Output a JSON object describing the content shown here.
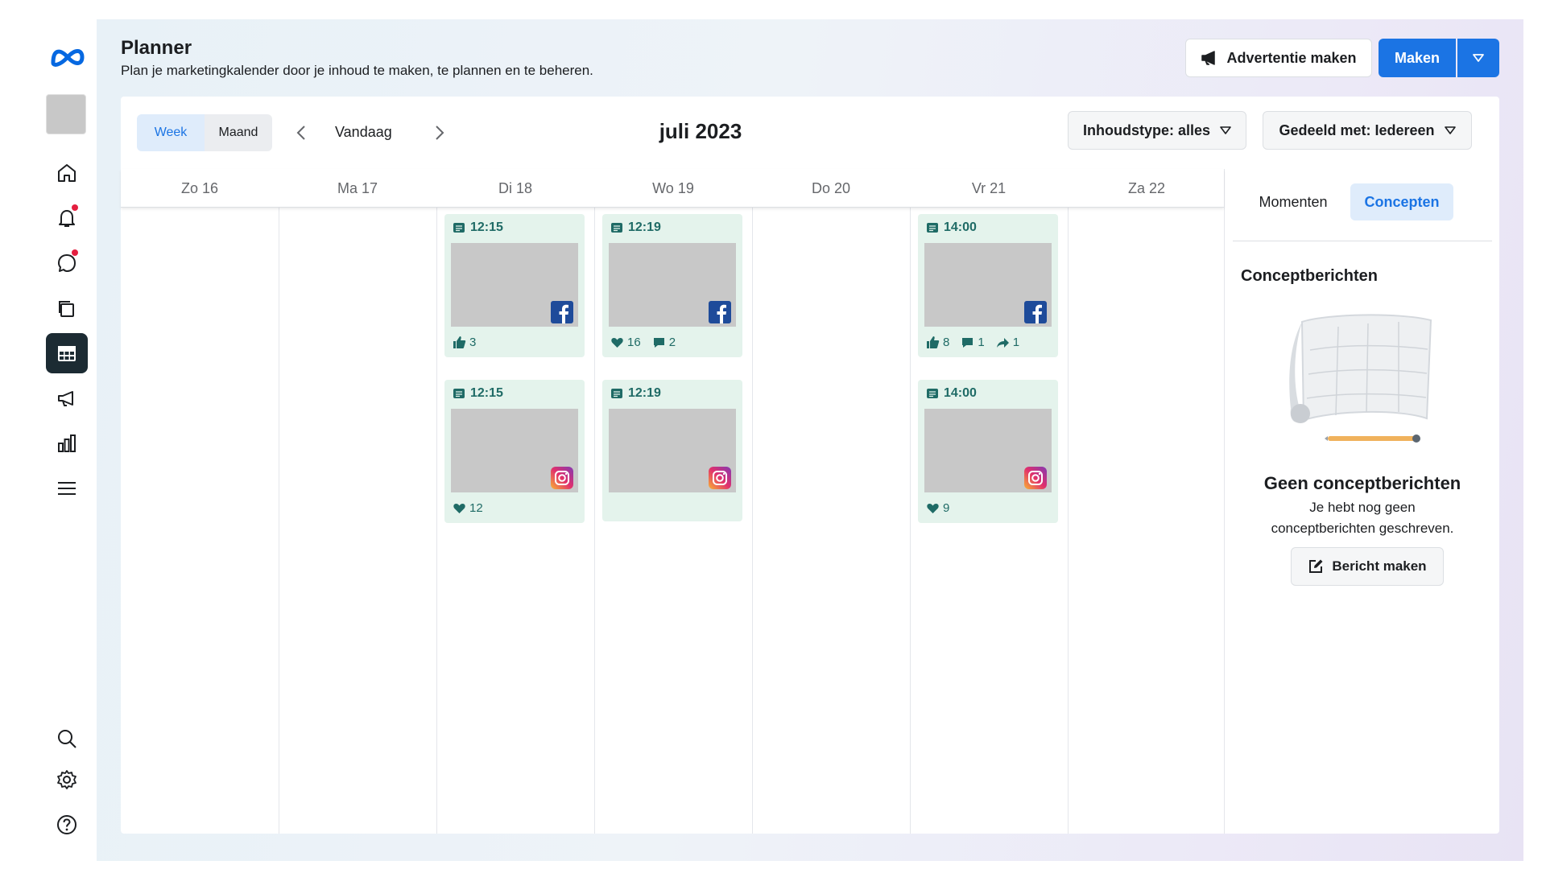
{
  "header": {
    "title": "Planner",
    "subtitle": "Plan je marketingkalender door je inhoud te maken, te plannen en te beheren.",
    "ad_button": "Advertentie maken",
    "make_button": "Maken"
  },
  "rail": {
    "items": [
      {
        "icon": "home-icon"
      },
      {
        "icon": "bell-icon",
        "badge": true
      },
      {
        "icon": "chat-icon",
        "badge": true
      },
      {
        "icon": "pages-icon"
      },
      {
        "icon": "calendar-icon",
        "active": true
      },
      {
        "icon": "megaphone-icon"
      },
      {
        "icon": "bar-chart-icon"
      },
      {
        "icon": "menu-icon"
      }
    ],
    "bottom": [
      {
        "icon": "search-icon"
      },
      {
        "icon": "gear-icon"
      },
      {
        "icon": "help-icon"
      }
    ]
  },
  "toolbar": {
    "view_week": "Week",
    "view_month": "Maand",
    "today": "Vandaag",
    "month": "juli 2023",
    "filter_type": "Inhoudstype: alles",
    "filter_shared": "Gedeeld met: Iedereen"
  },
  "days": [
    "Zo 16",
    "Ma 17",
    "Di 18",
    "Wo 19",
    "Do 20",
    "Vr 21",
    "Za 22"
  ],
  "posts": {
    "di_fb": {
      "time": "12:15",
      "likes": "3"
    },
    "wo_fb": {
      "time": "12:19",
      "hearts": "16",
      "comments": "2"
    },
    "vr_fb": {
      "time": "14:00",
      "likes": "8",
      "comments": "1",
      "shares": "1"
    },
    "di_ig": {
      "time": "12:15",
      "hearts": "12"
    },
    "wo_ig": {
      "time": "12:19"
    },
    "vr_ig": {
      "time": "14:00",
      "hearts": "9"
    }
  },
  "panel": {
    "tab_moments": "Momenten",
    "tab_drafts": "Concepten",
    "title": "Conceptberichten",
    "empty_title": "Geen conceptberichten",
    "empty_text": "Je hebt nog geen conceptberichten geschreven.",
    "button": "Bericht maken"
  },
  "colors": {
    "accent": "#1b74e4",
    "post_bg": "#e4f3ec",
    "post_text": "#1f6b66",
    "facebook": "#1e4b9a"
  }
}
